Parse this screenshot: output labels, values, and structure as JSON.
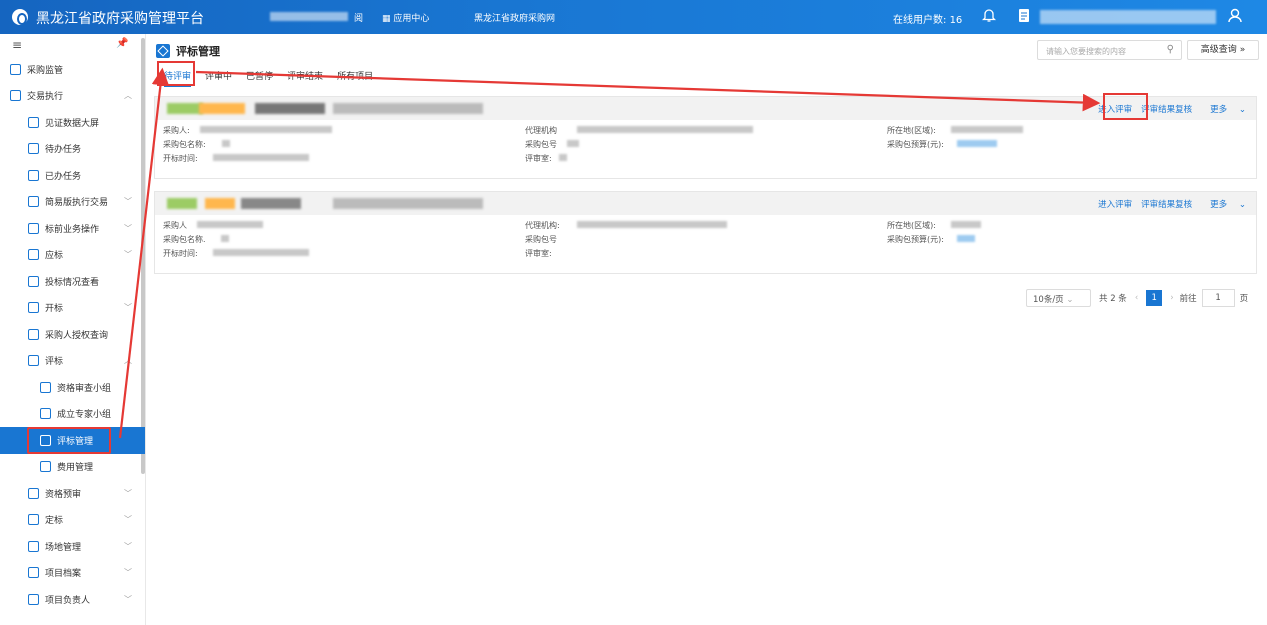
{
  "header": {
    "title": "黑龙江省政府采购管理平台",
    "nav_suffix": "阅",
    "app_center": "应用中心",
    "gov_site": "黑龙江省政府采购网",
    "online_label": "在线用户数:",
    "online_count": "16"
  },
  "sidebar": {
    "items": [
      {
        "label": "采购监管",
        "level": 0
      },
      {
        "label": "交易执行",
        "level": 0,
        "chev": "^"
      },
      {
        "label": "见证数据大屏",
        "level": 1
      },
      {
        "label": "待办任务",
        "level": 1
      },
      {
        "label": "已办任务",
        "level": 1
      },
      {
        "label": "简易版执行交易",
        "level": 1,
        "chev": "v"
      },
      {
        "label": "标前业务操作",
        "level": 1,
        "chev": "v"
      },
      {
        "label": "应标",
        "level": 1,
        "chev": "v"
      },
      {
        "label": "投标情况查看",
        "level": 1
      },
      {
        "label": "开标",
        "level": 1,
        "chev": "v"
      },
      {
        "label": "采购人授权查询",
        "level": 1
      },
      {
        "label": "评标",
        "level": 1,
        "chev": "^"
      },
      {
        "label": "资格审查小组",
        "level": 2
      },
      {
        "label": "成立专家小组",
        "level": 2
      },
      {
        "label": "评标管理",
        "level": 2,
        "active": true
      },
      {
        "label": "费用管理",
        "level": 2
      },
      {
        "label": "资格预审",
        "level": 1,
        "chev": "v"
      },
      {
        "label": "定标",
        "level": 1,
        "chev": "v"
      },
      {
        "label": "场地管理",
        "level": 1,
        "chev": "v"
      },
      {
        "label": "项目档案",
        "level": 1,
        "chev": "v"
      },
      {
        "label": "项目负责人",
        "level": 1,
        "chev": "v"
      }
    ]
  },
  "main": {
    "title": "评标管理",
    "search_placeholder": "请输入您要搜索的内容",
    "advanced": "高级查询",
    "tabs": [
      "待评审",
      "评审中",
      "已暂停",
      "评审结束",
      "所有项目"
    ],
    "card_labels": {
      "buyer": "采购人:",
      "pkg_name": "采购包名称:",
      "open_time": "开标时间:",
      "agency": "代理机构",
      "pkg_no": "采购包号",
      "room": "评审室:",
      "region": "所在地(区域):",
      "budget": "采购包预算(元):"
    },
    "card2_labels": {
      "buyer": "采购人",
      "pkg_name": "采购包名称.",
      "open_time": "开标时间:",
      "agency": "代理机构:",
      "pkg_no": "采购包号",
      "room": "评审室:",
      "region": "所在地(区域):",
      "budget": "采购包预算(元):"
    },
    "actions": {
      "enter": "进入评审",
      "recheck": "评审结果复核",
      "more": "更多"
    }
  },
  "pager": {
    "page_size": "10条/页",
    "total": "共 2 条",
    "current": "1",
    "goto_label": "前往",
    "goto_value": "1",
    "page_suffix": "页"
  },
  "colors": {
    "primary": "#1976d2",
    "annotation": "#e53935"
  }
}
